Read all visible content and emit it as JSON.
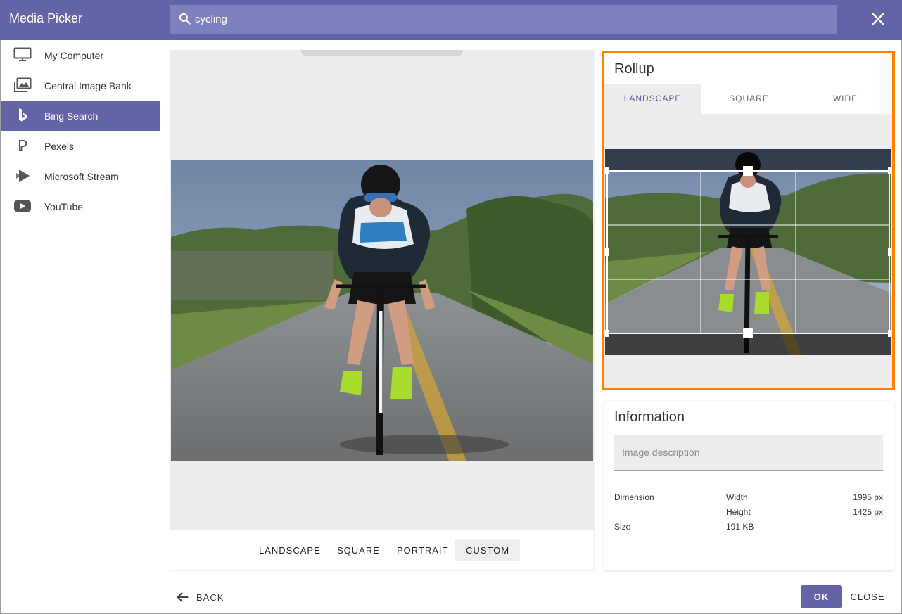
{
  "header": {
    "title": "Media Picker",
    "search_value": "cycling",
    "close_icon": "close-icon"
  },
  "sidebar": {
    "items": [
      {
        "label": "My Computer",
        "icon": "monitor-icon",
        "active": false
      },
      {
        "label": "Central Image Bank",
        "icon": "image-stack-icon",
        "active": false
      },
      {
        "label": "Bing Search",
        "icon": "bing-icon",
        "active": true
      },
      {
        "label": "Pexels",
        "icon": "pexels-icon",
        "active": false
      },
      {
        "label": "Microsoft Stream",
        "icon": "stream-icon",
        "active": false
      },
      {
        "label": "YouTube",
        "icon": "youtube-icon",
        "active": false
      }
    ]
  },
  "preview": {
    "crop_options": [
      "LANDSCAPE",
      "SQUARE",
      "PORTRAIT",
      "CUSTOM"
    ],
    "selected_crop": "CUSTOM"
  },
  "rollup": {
    "title": "Rollup",
    "tabs": [
      "LANDSCAPE",
      "SQUARE",
      "WIDE"
    ],
    "active_tab": "LANDSCAPE"
  },
  "information": {
    "title": "Information",
    "description_placeholder": "Image description",
    "dimension_label": "Dimension",
    "width_label": "Width",
    "width_value": "1995 px",
    "height_label": "Height",
    "height_value": "1425 px",
    "size_label": "Size",
    "size_value": "191 KB"
  },
  "footer": {
    "back_label": "BACK",
    "ok_label": "OK",
    "close_label": "CLOSE"
  },
  "colors": {
    "brand": "#6264a7",
    "highlight_border": "#ff8000"
  }
}
